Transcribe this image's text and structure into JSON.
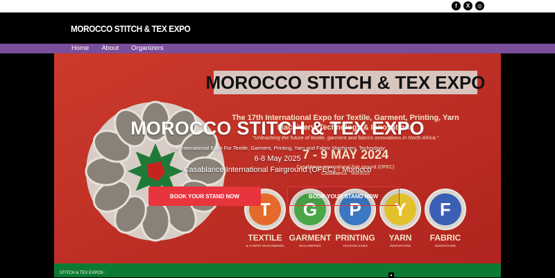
{
  "topbar": {
    "social": [
      {
        "icon": "facebook-icon",
        "glyph": "f"
      },
      {
        "icon": "x-icon",
        "glyph": "X"
      },
      {
        "icon": "instagram-icon",
        "glyph": "◎"
      }
    ]
  },
  "header": {
    "brand": "MOROCCO STITCH & TEX EXPO"
  },
  "nav": {
    "items": [
      "Home",
      "About",
      "Organizers"
    ]
  },
  "poster": {
    "title": "MOROCCO STITCH & TEX EXPO",
    "edition_sup": "th",
    "edition_line": "The 17th International Expo for Textile, Garment, Printing, Yarn",
    "edition_line_2": "Machinery, Technology & Innovations",
    "tagline": "\"Unleashing the future of textile, garment and fabrics innovations in North Africa.\"",
    "dates": "7 - 9 MAY 2024",
    "venue_1": "Casablanca International Fair ground (OFEC)",
    "venue_2": "Casablanca - Morocco",
    "sectors": [
      {
        "letter": "T",
        "name": "TEXTILE",
        "sub": "& CARPET MACHINERIES",
        "color": "#e46a2b"
      },
      {
        "letter": "G",
        "name": "GARMENT",
        "sub": "MACHINERIES",
        "color": "#4aa647"
      },
      {
        "letter": "P",
        "name": "PRINTING",
        "sub": "TECHNOLOGIES",
        "color": "#3a78c3"
      },
      {
        "letter": "Y",
        "name": "YARN",
        "sub": "INNOVATIONS",
        "color": "#e3c12d"
      },
      {
        "letter": "F",
        "name": "FABRIC",
        "sub": "INNOVATIONS",
        "color": "#3a5fb5"
      }
    ]
  },
  "hero": {
    "title": "MOROCCO STITCH & TEX EXPO",
    "subtitle": "The International Expo For Textile, Garment, Printing, Yarn and Fabric Machinery, Technology",
    "date": "6-8 May 2025",
    "venue": "Casablance International Fairground (OFEC) - Morocco",
    "cta_primary": "BOOK YOUR STAND NOW",
    "cta_secondary": "BOOK YOUR STAND NOW"
  },
  "footer": {
    "label": "STITCH & TEX EXPOS :"
  },
  "colors": {
    "nav_bg": "#7a4e9b",
    "hero_red": "#c12d28",
    "cta_red": "#e8343d",
    "footer_green": "#0d7a33"
  }
}
